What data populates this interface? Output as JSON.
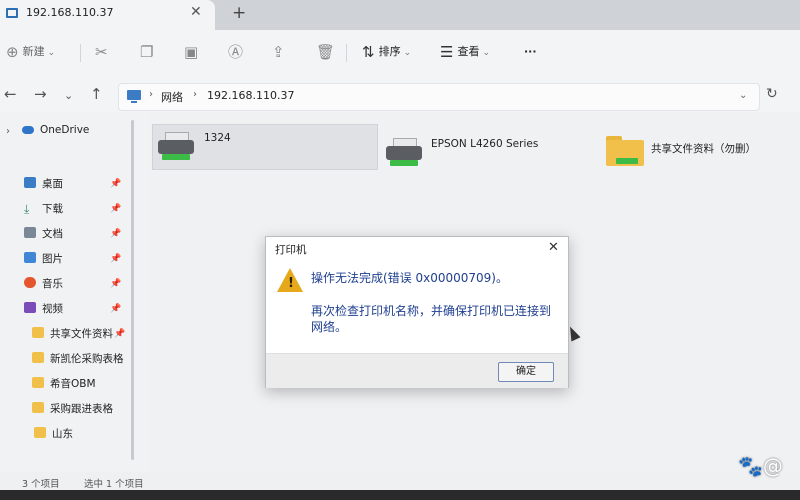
{
  "tab": {
    "title": "192.168.110.37",
    "close": "✕",
    "new": "+"
  },
  "toolbar": {
    "new_label": "新建",
    "sort_label": "排序",
    "view_label": "查看",
    "more": "···"
  },
  "address": {
    "crumbs": [
      "网络",
      "192.168.110.37"
    ]
  },
  "sidebar": {
    "onedrive": "OneDrive",
    "items": [
      {
        "label": "桌面",
        "color": "#3b7cc4"
      },
      {
        "label": "下载",
        "color": "#2f8f5f"
      },
      {
        "label": "文档",
        "color": "#7a8797"
      },
      {
        "label": "图片",
        "color": "#3f87d6"
      },
      {
        "label": "音乐",
        "color": "#e4572e"
      },
      {
        "label": "视频",
        "color": "#7b4bb7"
      },
      {
        "label": "共享文件资料",
        "color": "#f1c04a"
      },
      {
        "label": "新凯伦采购表格",
        "color": "#f1c04a"
      },
      {
        "label": "希音OBM",
        "color": "#f1c04a"
      },
      {
        "label": "采购跟进表格",
        "color": "#f1c04a"
      },
      {
        "label": "山东",
        "color": "#f1c04a"
      }
    ]
  },
  "files": [
    {
      "name": "1324"
    },
    {
      "name": "EPSON L4260 Series"
    },
    {
      "name": "共享文件资料（勿删）"
    }
  ],
  "status": {
    "count": "3 个项目",
    "selected": "选中 1 个项目"
  },
  "dialog": {
    "title": "打印机",
    "message": "操作无法完成(错误 0x00000709)。",
    "hint": "再次检查打印机名称，并确保打印机已连接到网络。",
    "ok_label": "确定"
  },
  "colors": {
    "accent": "#1f3f8f",
    "warning": "#e6a91c",
    "folder": "#f1c04a"
  }
}
